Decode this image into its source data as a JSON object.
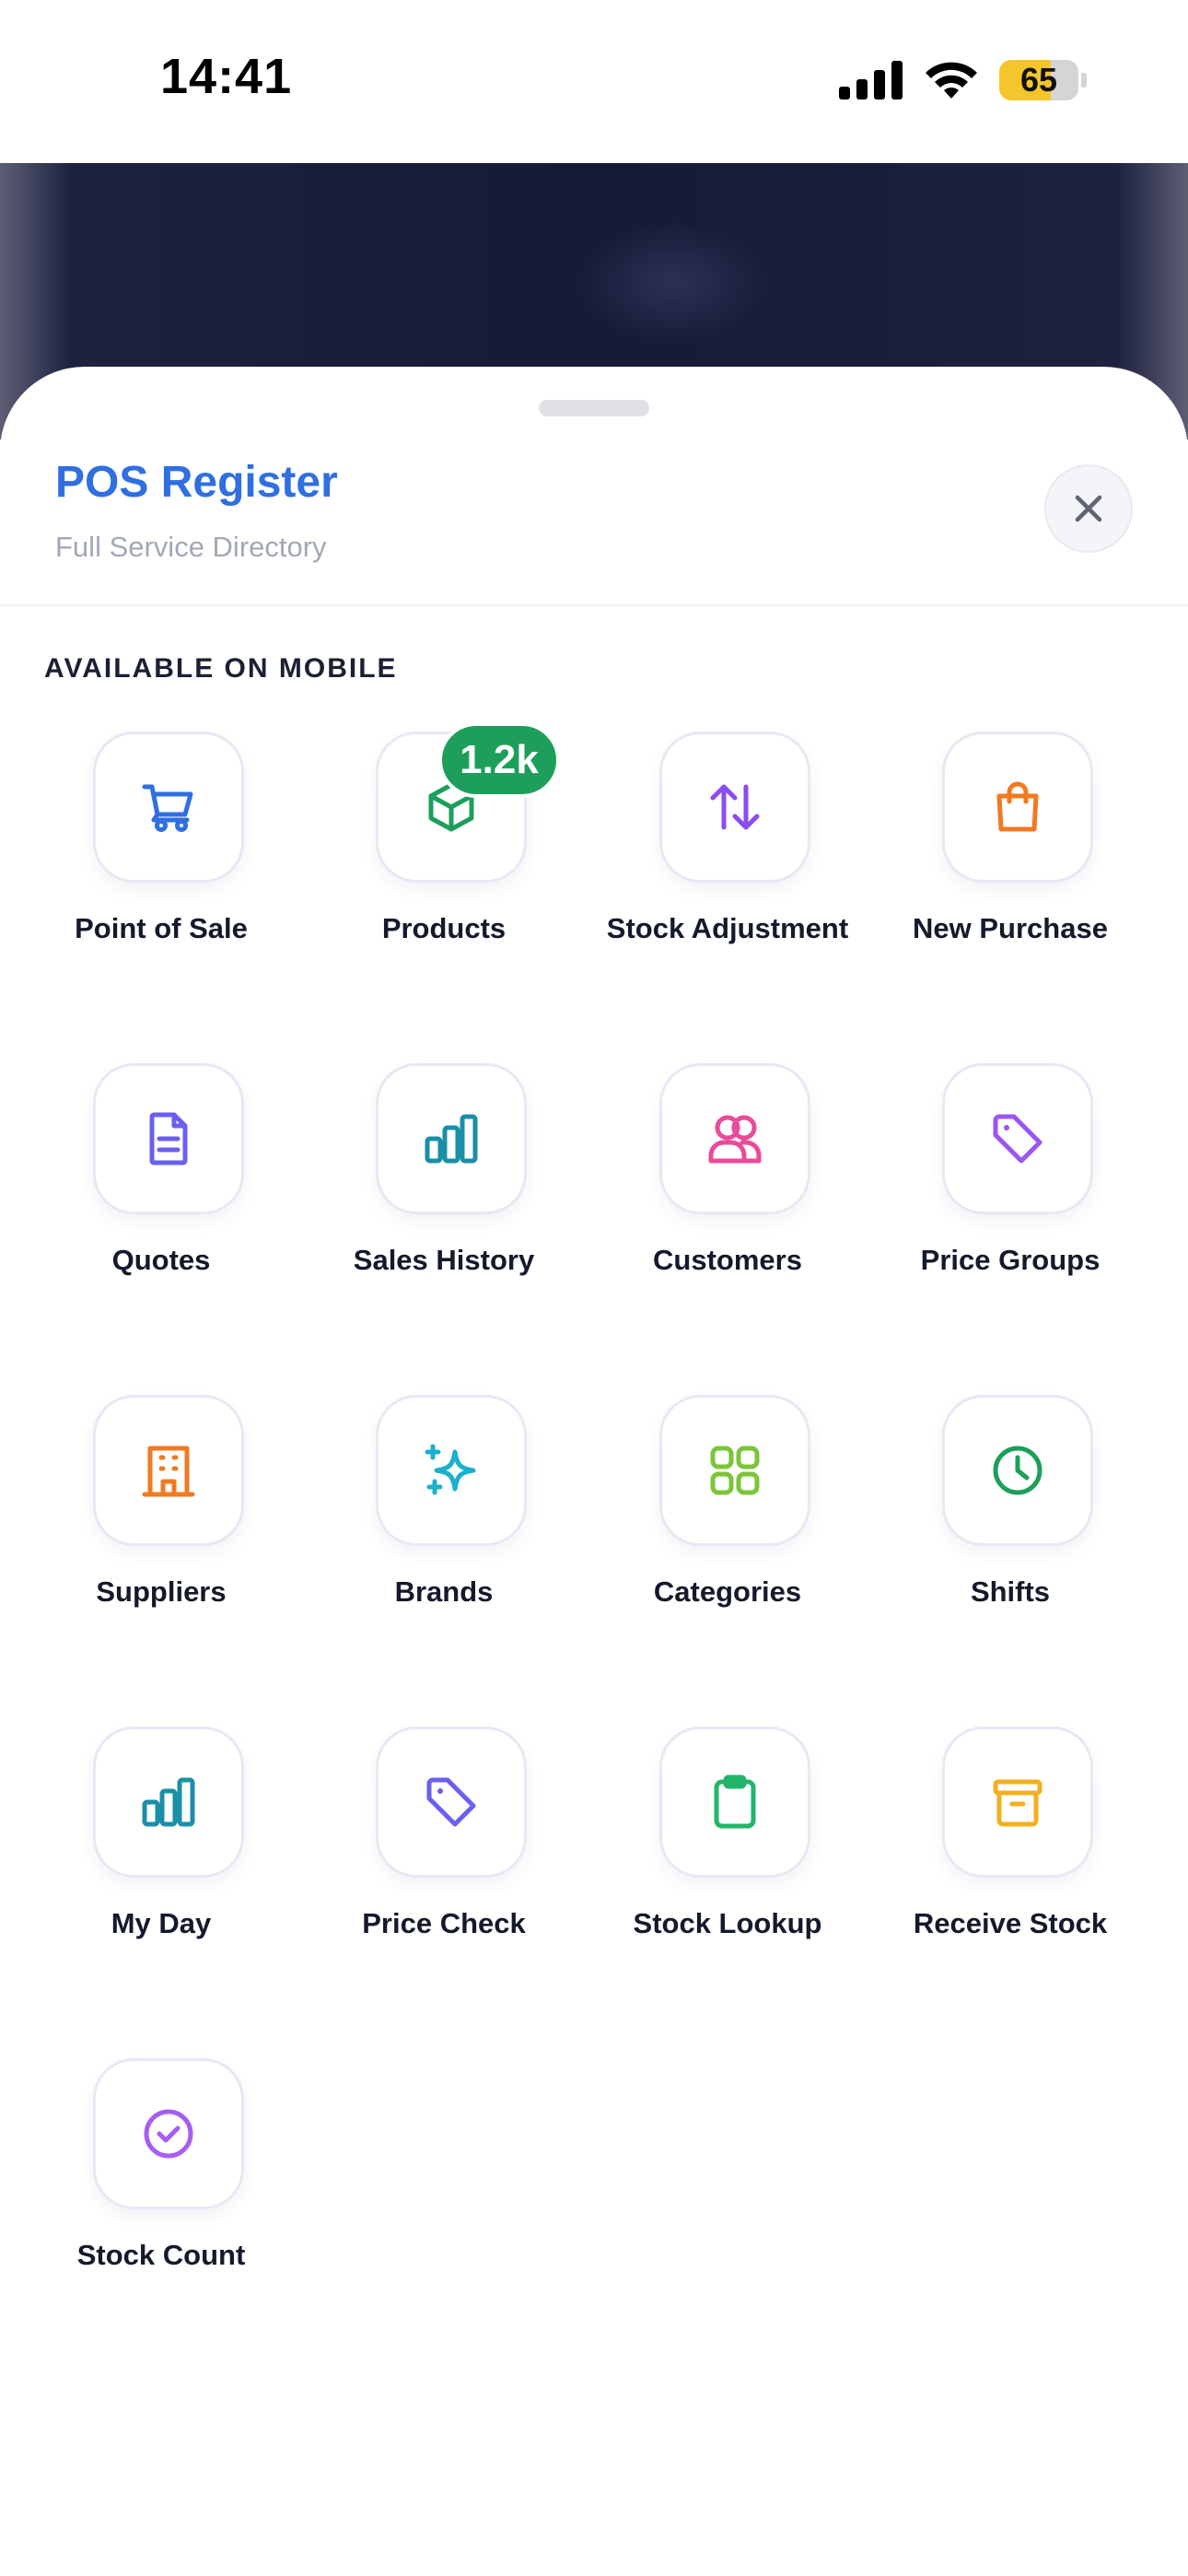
{
  "status_bar": {
    "time": "14:41",
    "battery_level": "65",
    "battery_fraction": 0.65
  },
  "sheet": {
    "title": "POS Register",
    "subtitle": "Full Service Directory",
    "close_icon": "close-icon"
  },
  "section": {
    "label": "AVAILABLE ON MOBILE"
  },
  "tiles": [
    {
      "label": "Point of Sale",
      "icon": "cart-icon",
      "color": "#2f6fe0"
    },
    {
      "label": "Products",
      "icon": "box-icon",
      "color": "#1d9f5b",
      "badge": "1.2k"
    },
    {
      "label": "Stock Adjustment",
      "icon": "arrows-up-down-icon",
      "color": "#8b4cf0"
    },
    {
      "label": "New Purchase",
      "icon": "shopping-bag-icon",
      "color": "#f07a22"
    },
    {
      "label": "Quotes",
      "icon": "document-icon",
      "color": "#6a5ff0"
    },
    {
      "label": "Sales History",
      "icon": "bar-chart-icon",
      "color": "#1b8fa6"
    },
    {
      "label": "Customers",
      "icon": "users-icon",
      "color": "#e84b9a"
    },
    {
      "label": "Price Groups",
      "icon": "tag-icon",
      "color": "#9b55f0"
    },
    {
      "label": "Suppliers",
      "icon": "building-icon",
      "color": "#f07a22"
    },
    {
      "label": "Brands",
      "icon": "sparkles-icon",
      "color": "#1bb0cc"
    },
    {
      "label": "Categories",
      "icon": "grid-icon",
      "color": "#7cc43a"
    },
    {
      "label": "Shifts",
      "icon": "clock-icon",
      "color": "#1d9f5b"
    },
    {
      "label": "My Day",
      "icon": "bar-chart-icon",
      "color": "#1b8fa6"
    },
    {
      "label": "Price Check",
      "icon": "tag-icon",
      "color": "#6a5ff0"
    },
    {
      "label": "Stock Lookup",
      "icon": "clipboard-icon",
      "color": "#22b56a"
    },
    {
      "label": "Receive Stock",
      "icon": "archive-icon",
      "color": "#f2b01e"
    },
    {
      "label": "Stock Count",
      "icon": "check-circle-icon",
      "color": "#a55ff0"
    }
  ]
}
